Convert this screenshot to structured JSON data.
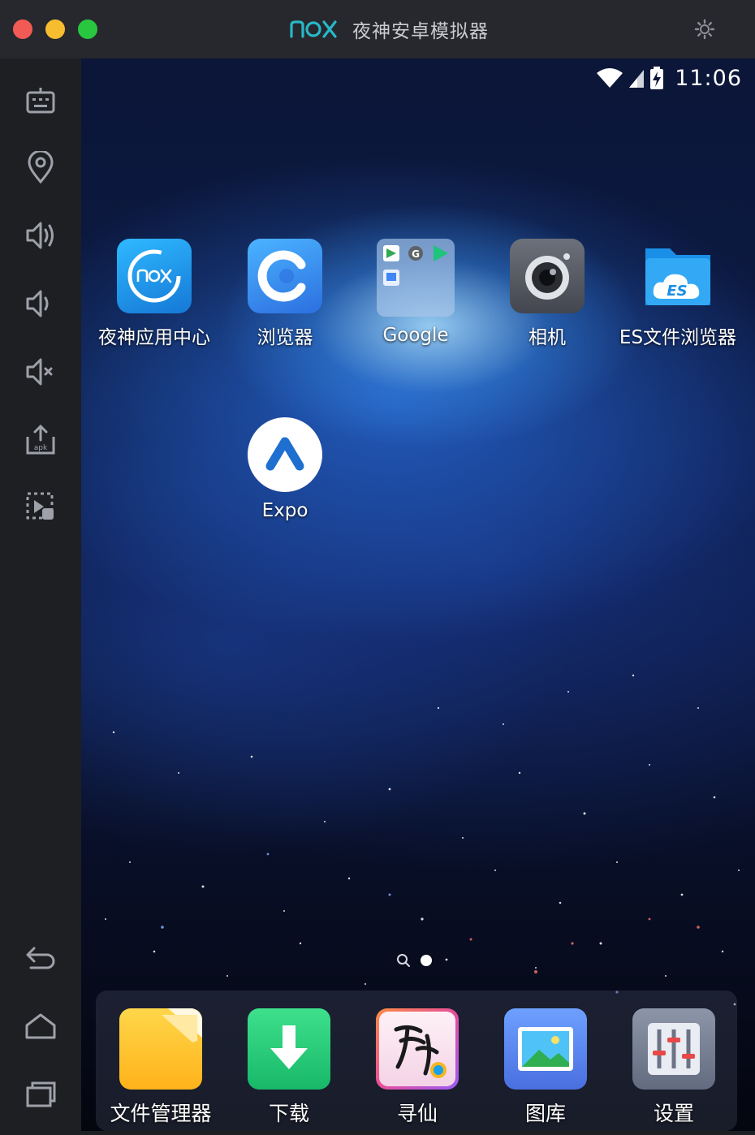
{
  "window": {
    "title": "夜神安卓模拟器",
    "logo_text": "nox"
  },
  "sidebar": {
    "items": [
      {
        "icon": "keyboard-icon"
      },
      {
        "icon": "location-icon"
      },
      {
        "icon": "volume-up-icon"
      },
      {
        "icon": "volume-down-icon"
      },
      {
        "icon": "mute-icon"
      },
      {
        "icon": "install-apk-icon"
      },
      {
        "icon": "macro-record-icon"
      },
      {
        "icon": "back-icon"
      },
      {
        "icon": "home-icon"
      },
      {
        "icon": "recent-apps-icon"
      }
    ]
  },
  "statusbar": {
    "time": "11:06",
    "icons": [
      "wifi-icon",
      "signal-icon",
      "battery-charging-icon"
    ]
  },
  "home": {
    "apps": [
      {
        "label": "夜神应用中心",
        "icon": "nox-app-center-icon"
      },
      {
        "label": "浏览器",
        "icon": "browser-icon"
      },
      {
        "label": "Google",
        "icon": "google-folder-icon"
      },
      {
        "label": "相机",
        "icon": "camera-icon"
      },
      {
        "label": "ES文件浏览器",
        "icon": "es-file-explorer-icon"
      },
      {
        "label": "Expo",
        "icon": "expo-icon"
      }
    ],
    "page_indicator": {
      "pages": 1,
      "active": 1
    }
  },
  "dock": {
    "apps": [
      {
        "label": "文件管理器",
        "icon": "file-manager-icon"
      },
      {
        "label": "下载",
        "icon": "download-icon"
      },
      {
        "label": "寻仙",
        "icon": "xunxian-game-icon"
      },
      {
        "label": "图库",
        "icon": "gallery-icon"
      },
      {
        "label": "设置",
        "icon": "settings-icon"
      }
    ]
  },
  "colors": {
    "accent": "#27b8c8",
    "titlebar": "#27282d",
    "sidebar": "#1e1f23"
  }
}
